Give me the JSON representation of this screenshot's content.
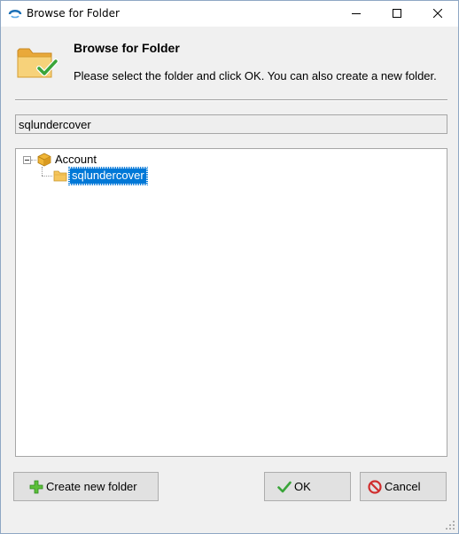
{
  "window": {
    "title": "Browse for Folder"
  },
  "header": {
    "title": "Browse for Folder",
    "description": "Please select the folder and click OK. You can also create a new folder."
  },
  "path": {
    "value": "sqlundercover"
  },
  "tree": {
    "root": {
      "label": "Account",
      "expanded": true,
      "icon": "package-icon"
    },
    "children": [
      {
        "label": "sqlundercover",
        "selected": true,
        "icon": "folder-icon"
      }
    ]
  },
  "buttons": {
    "create_label": "Create new folder",
    "ok_label": "OK",
    "cancel_label": "Cancel"
  },
  "colors": {
    "selection": "#0078d7",
    "folder": "#f5c55c",
    "check": "#3aa53a",
    "cancel": "#d02e2e"
  }
}
